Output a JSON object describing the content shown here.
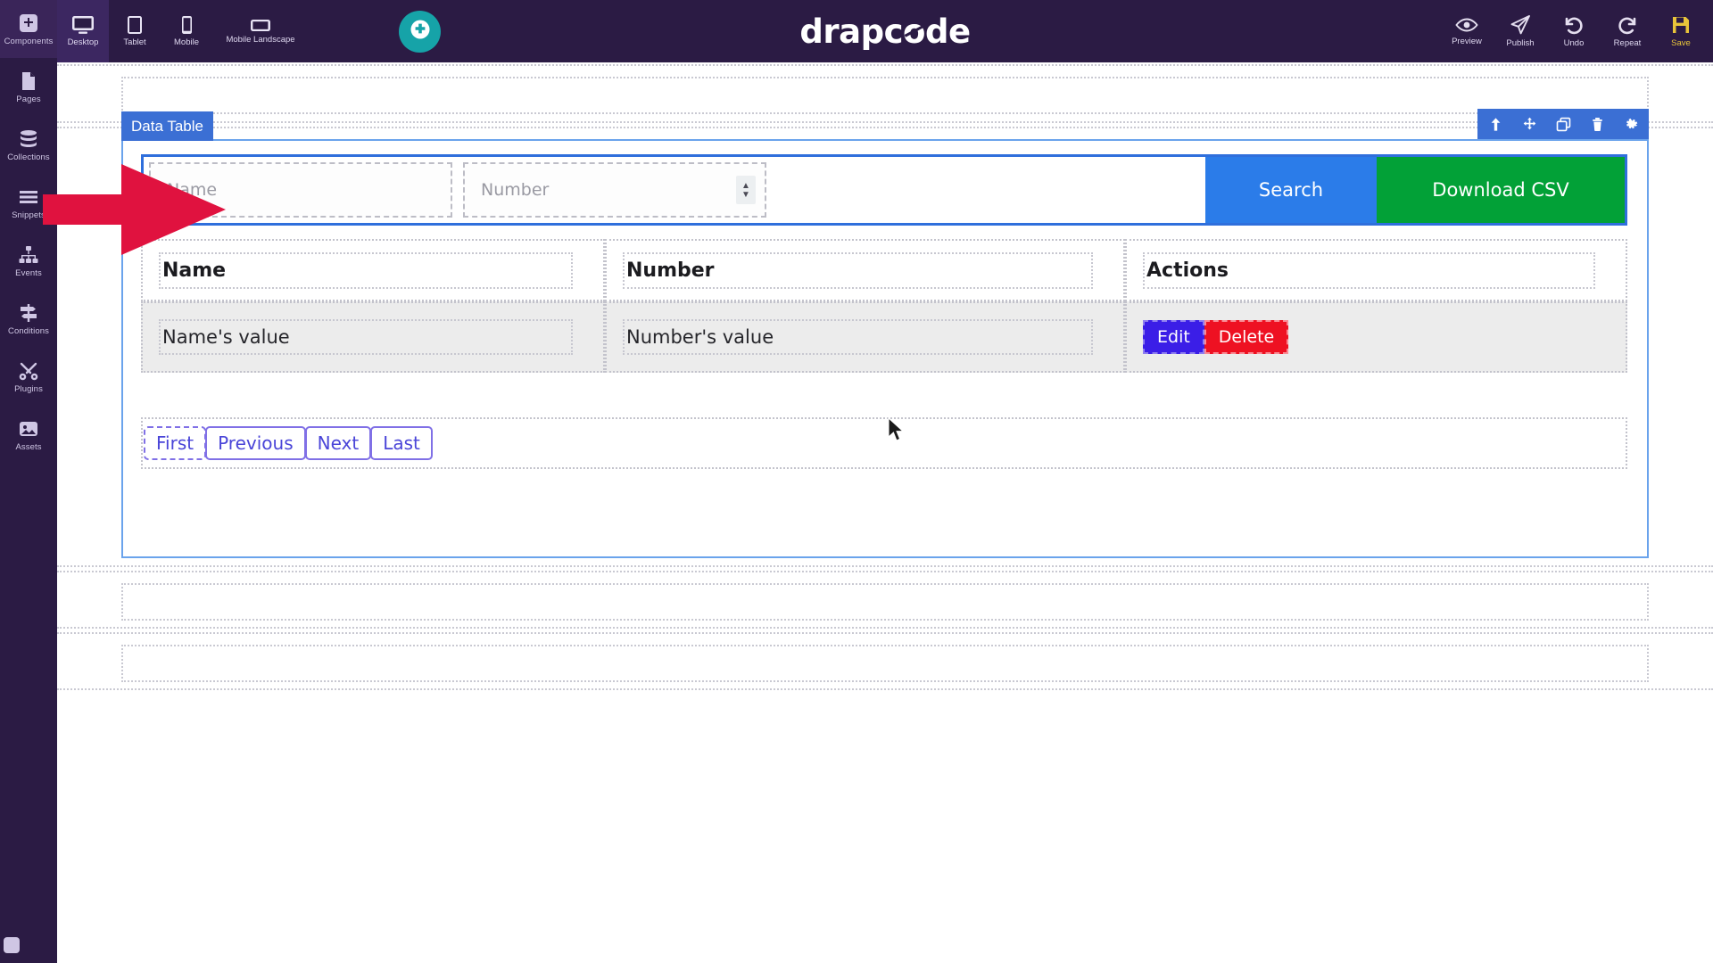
{
  "app": {
    "brand": "drapcode",
    "brand_part1": "drapc",
    "brand_part2": "o",
    "brand_part3": "de"
  },
  "sidebar": {
    "items": [
      {
        "label": "Components",
        "icon": "plus-square-icon",
        "active": true
      },
      {
        "label": "Pages",
        "icon": "page-icon",
        "active": false
      },
      {
        "label": "Collections",
        "icon": "database-icon",
        "active": false
      },
      {
        "label": "Snippets",
        "icon": "lines-icon",
        "active": false
      },
      {
        "label": "Events",
        "icon": "sitemap-icon",
        "active": false
      },
      {
        "label": "Conditions",
        "icon": "signpost-icon",
        "active": false
      },
      {
        "label": "Plugins",
        "icon": "tools-icon",
        "active": false
      },
      {
        "label": "Assets",
        "icon": "image-icon",
        "active": false
      }
    ]
  },
  "topbar": {
    "devices": [
      {
        "label": "Desktop",
        "icon": "desktop-icon",
        "active": true
      },
      {
        "label": "Tablet",
        "icon": "tablet-icon",
        "active": false
      },
      {
        "label": "Mobile",
        "icon": "mobile-icon",
        "active": false
      },
      {
        "label": "Mobile Landscape",
        "icon": "mobile-landscape-icon",
        "active": false
      }
    ],
    "add_block": {
      "icon": "plus-circle-icon",
      "color": "#16a3a8"
    },
    "actions": [
      {
        "label": "Preview",
        "icon": "eye-icon"
      },
      {
        "label": "Publish",
        "icon": "send-icon"
      },
      {
        "label": "Undo",
        "icon": "undo-icon"
      },
      {
        "label": "Repeat",
        "icon": "redo-icon"
      },
      {
        "label": "Save",
        "icon": "floppy-disk-icon"
      }
    ]
  },
  "datatable": {
    "badge": "Data Table",
    "toolbar_icons": [
      "arrow-up-icon",
      "move-icon",
      "copy-icon",
      "trash-icon",
      "gear-icon"
    ],
    "search": {
      "name_placeholder": "Name",
      "number_placeholder": "Number",
      "number_spinner_up": "▲",
      "number_spinner_down": "▼",
      "search_label": "Search",
      "csv_label": "Download CSV",
      "search_color": "#2b7ce9",
      "csv_color": "#02a137"
    },
    "columns": [
      "Name",
      "Number",
      "Actions"
    ],
    "rows": [
      {
        "name": "Name's value",
        "number": "Number's value",
        "actions": [
          {
            "label": "Edit",
            "color": "#3b1ee7"
          },
          {
            "label": "Delete",
            "color": "#ee1122"
          }
        ]
      }
    ],
    "pagination": [
      "First",
      "Previous",
      "Next",
      "Last"
    ]
  },
  "annotation": {
    "arrow_color": "#e0123f",
    "points_at": "name-search-input"
  },
  "colors": {
    "sidebar_bg": "#2b1b44",
    "selection_blue": "#3b6fd4",
    "canvas_bg": "#ffffff"
  }
}
